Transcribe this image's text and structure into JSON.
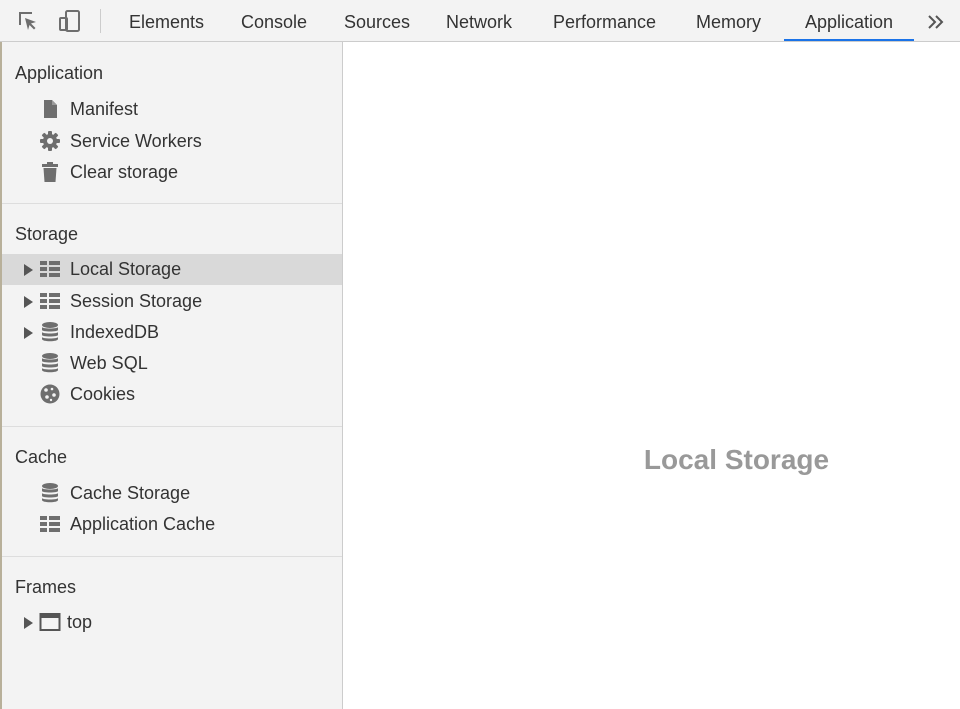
{
  "toolbar": {
    "tabs": [
      {
        "label": "Elements"
      },
      {
        "label": "Console"
      },
      {
        "label": "Sources"
      },
      {
        "label": "Network"
      },
      {
        "label": "Performance"
      },
      {
        "label": "Memory"
      },
      {
        "label": "Application",
        "active": true
      }
    ],
    "icons": [
      "inspect-icon",
      "device-toggle-icon",
      "more-tabs-icon"
    ]
  },
  "sidebar": {
    "sections": {
      "application": {
        "title": "Application",
        "items": [
          {
            "label": "Manifest",
            "icon": "file-icon"
          },
          {
            "label": "Service Workers",
            "icon": "gear-icon"
          },
          {
            "label": "Clear storage",
            "icon": "trash-icon"
          }
        ]
      },
      "storage": {
        "title": "Storage",
        "items": [
          {
            "label": "Local Storage",
            "icon": "table-icon",
            "expandable": true,
            "selected": true
          },
          {
            "label": "Session Storage",
            "icon": "table-icon",
            "expandable": true
          },
          {
            "label": "IndexedDB",
            "icon": "database-icon",
            "expandable": true
          },
          {
            "label": "Web SQL",
            "icon": "database-icon"
          },
          {
            "label": "Cookies",
            "icon": "cookie-icon"
          }
        ]
      },
      "cache": {
        "title": "Cache",
        "items": [
          {
            "label": "Cache Storage",
            "icon": "database-icon"
          },
          {
            "label": "Application Cache",
            "icon": "table-icon"
          }
        ]
      },
      "frames": {
        "title": "Frames",
        "items": [
          {
            "label": "top",
            "icon": "frame-icon",
            "expandable": true
          }
        ]
      }
    }
  },
  "main": {
    "title": "Local Storage"
  },
  "colors": {
    "accent": "#1a73e8",
    "sidebar_bg": "#f3f3f3",
    "selected_bg": "#d9d9d9",
    "icon": "#6e6e6e",
    "placeholder_text": "#999999"
  }
}
